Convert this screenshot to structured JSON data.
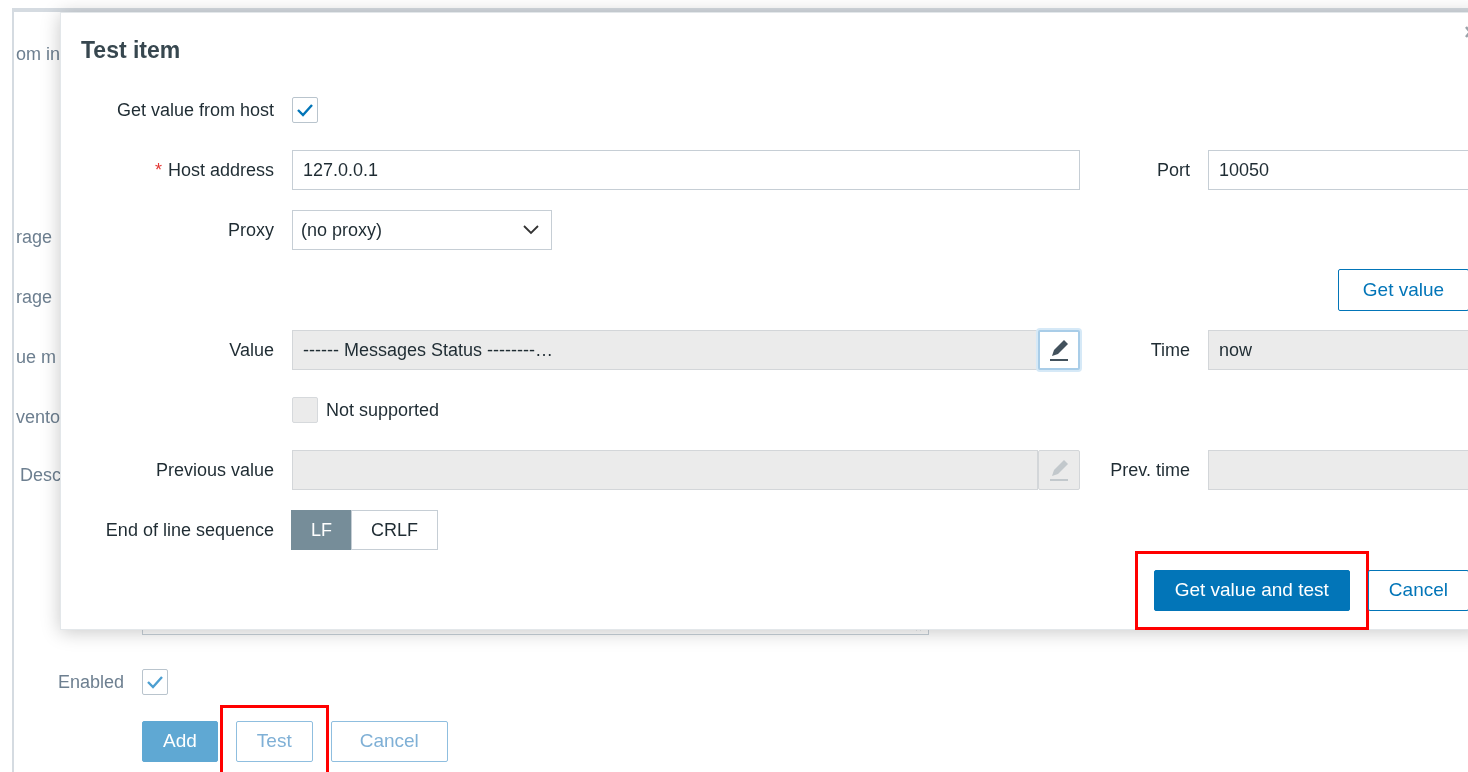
{
  "background_form": {
    "labels": [
      "om in",
      "rage",
      "rage",
      "ue m",
      "vento",
      "Desc"
    ],
    "enabled": {
      "label": "Enabled",
      "checked": true
    },
    "buttons": [
      {
        "label": "Add",
        "kind": "primary",
        "highlighted": false
      },
      {
        "label": "Test",
        "kind": "secondary",
        "highlighted": true
      },
      {
        "label": "Cancel",
        "kind": "secondary",
        "highlighted": false
      }
    ]
  },
  "dialog": {
    "title": "Test item",
    "get_value_from_host": {
      "label": "Get value from host",
      "checked": true
    },
    "host_address": {
      "label": "Host address",
      "required_mark": "*",
      "value": "127.0.0.1"
    },
    "port": {
      "label": "Port",
      "value": "10050"
    },
    "proxy": {
      "label": "Proxy",
      "value": "(no proxy)"
    },
    "get_value_button": "Get value",
    "value": {
      "label": "Value",
      "value": "------ Messages Status --------…"
    },
    "time": {
      "label": "Time",
      "value": "now"
    },
    "not_supported": {
      "label": "Not supported",
      "checked": false,
      "disabled": true
    },
    "previous_value": {
      "label": "Previous value"
    },
    "prev_time": {
      "label": "Prev. time"
    },
    "end_of_line": {
      "label": "End of line sequence",
      "options": [
        {
          "label": "LF",
          "selected": true
        },
        {
          "label": "CRLF",
          "selected": false
        }
      ]
    },
    "buttons": [
      {
        "label": "Get value and test",
        "kind": "primary",
        "highlighted": true
      },
      {
        "label": "Cancel",
        "kind": "secondary",
        "highlighted": false
      }
    ]
  }
}
